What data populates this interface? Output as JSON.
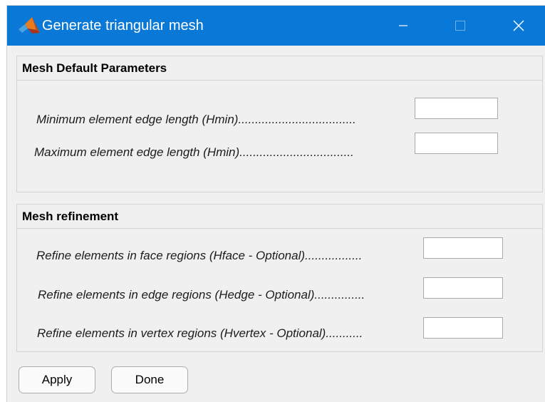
{
  "window": {
    "title": "Generate triangular mesh",
    "colors": {
      "titlebar": "#0a78d7",
      "background": "#f0f0f0"
    }
  },
  "mesh_defaults": {
    "header": "Mesh Default Parameters",
    "fields": [
      {
        "label": "Minimum element edge length (Hmin)...................................",
        "value": ""
      },
      {
        "label": "Maximum element edge length (Hmin)..................................",
        "value": ""
      }
    ]
  },
  "mesh_refinement": {
    "header": "Mesh refinement",
    "fields": [
      {
        "label": "Refine elements in face regions (Hface - Optional).................",
        "value": ""
      },
      {
        "label": "Refine elements in edge regions (Hedge - Optional)...............",
        "value": ""
      },
      {
        "label": "Refine elements in vertex regions (Hvertex - Optional)...........",
        "value": ""
      }
    ]
  },
  "buttons": {
    "apply": "Apply",
    "done": "Done"
  }
}
